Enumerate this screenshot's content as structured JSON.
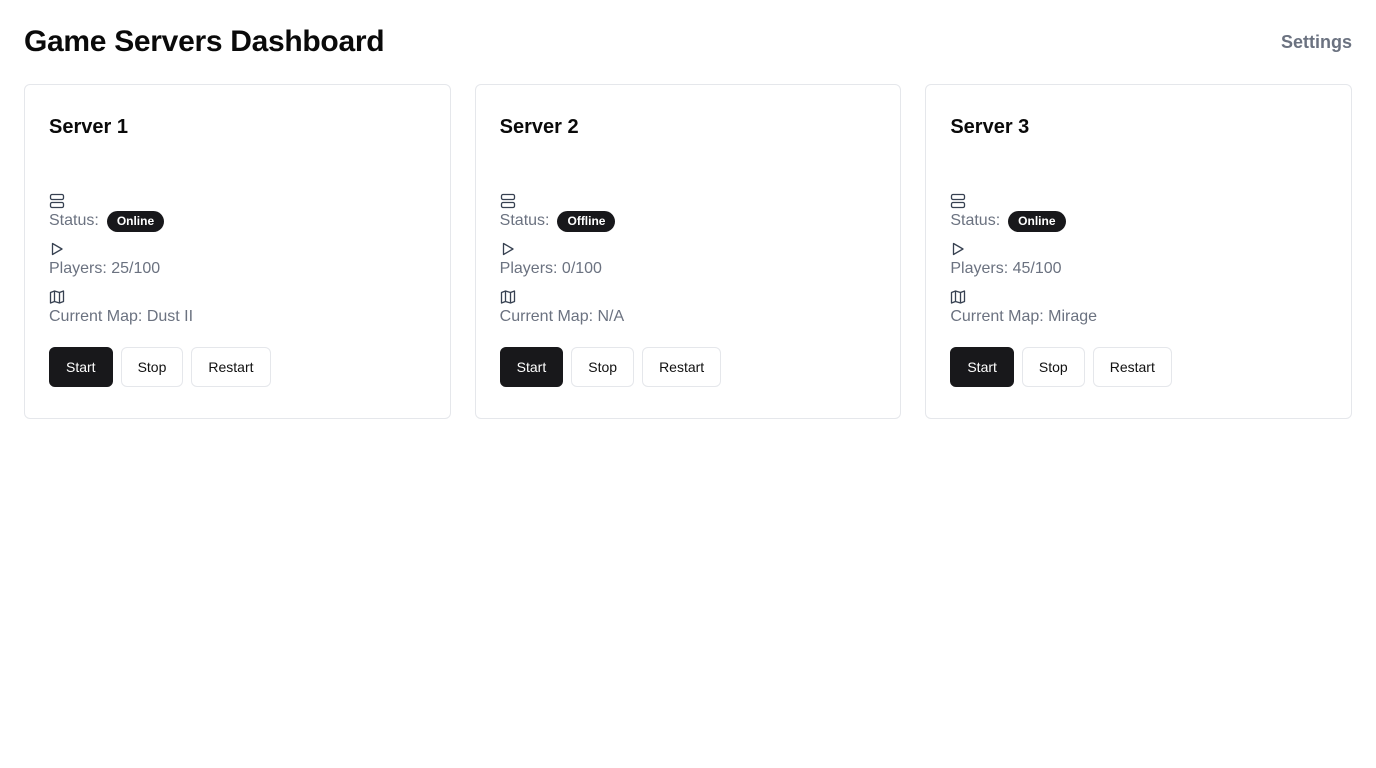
{
  "header": {
    "title": "Game Servers Dashboard",
    "settings_label": "Settings"
  },
  "servers": [
    {
      "name": "Server 1",
      "status_label": "Status:",
      "status": "Online",
      "players_text": "Players: 25/100",
      "map_text": "Current Map: Dust II",
      "start_label": "Start",
      "stop_label": "Stop",
      "restart_label": "Restart"
    },
    {
      "name": "Server 2",
      "status_label": "Status:",
      "status": "Offline",
      "players_text": "Players: 0/100",
      "map_text": "Current Map: N/A",
      "start_label": "Start",
      "stop_label": "Stop",
      "restart_label": "Restart"
    },
    {
      "name": "Server 3",
      "status_label": "Status:",
      "status": "Online",
      "players_text": "Players: 45/100",
      "map_text": "Current Map: Mirage",
      "start_label": "Start",
      "stop_label": "Stop",
      "restart_label": "Restart"
    }
  ],
  "icons": {
    "status": "server-icon",
    "players": "play-icon",
    "map": "map-icon"
  },
  "colors": {
    "primary": "#18181b",
    "muted_text": "#6b7280",
    "border": "#e5e7eb"
  }
}
